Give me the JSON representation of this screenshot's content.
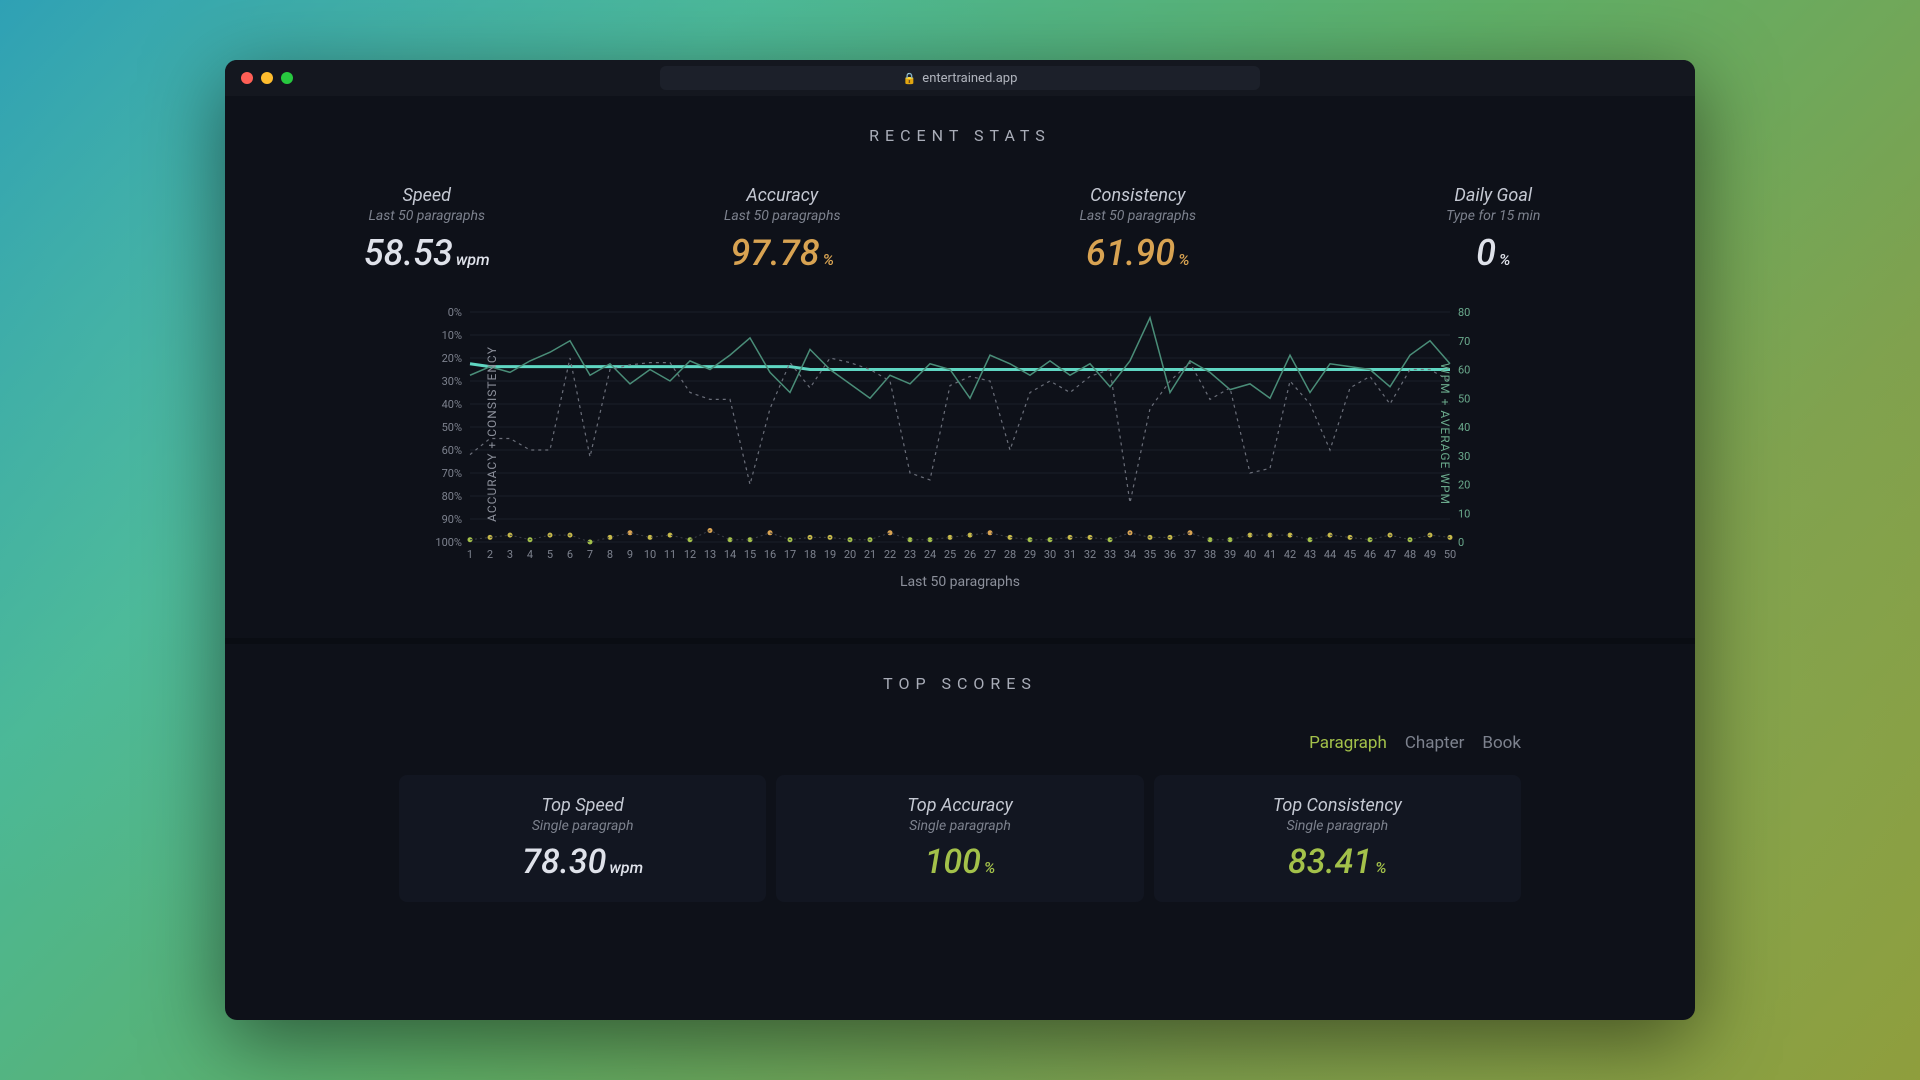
{
  "browser": {
    "url": "entertrained.app"
  },
  "recent": {
    "title": "RECENT STATS",
    "cards": [
      {
        "title": "Speed",
        "sub": "Last 50 paragraphs",
        "value": "58.53",
        "unit": "wpm",
        "color": "c-white"
      },
      {
        "title": "Accuracy",
        "sub": "Last 50 paragraphs",
        "value": "97.78",
        "unit": "%",
        "color": "c-orange"
      },
      {
        "title": "Consistency",
        "sub": "Last 50 paragraphs",
        "value": "61.90",
        "unit": "%",
        "color": "c-orange"
      },
      {
        "title": "Daily Goal",
        "sub": "Type for 15 min",
        "value": "0",
        "unit": "%",
        "color": "c-white"
      }
    ]
  },
  "chart_data": {
    "type": "line",
    "title": "",
    "xlabel": "Last 50 paragraphs",
    "left_axis": {
      "label": "ACCURACY + CONSISTENCY",
      "ticks": [
        "0%",
        "10%",
        "20%",
        "30%",
        "40%",
        "50%",
        "60%",
        "70%",
        "80%",
        "90%",
        "100%"
      ],
      "range": [
        0,
        100
      ]
    },
    "right_axis": {
      "label": "WPM + AVERAGE WPM",
      "ticks": [
        "0",
        "10",
        "20",
        "30",
        "40",
        "50",
        "60",
        "70",
        "80"
      ],
      "range": [
        0,
        80
      ]
    },
    "x": [
      1,
      2,
      3,
      4,
      5,
      6,
      7,
      8,
      9,
      10,
      11,
      12,
      13,
      14,
      15,
      16,
      17,
      18,
      19,
      20,
      21,
      22,
      23,
      24,
      25,
      26,
      27,
      28,
      29,
      30,
      31,
      32,
      33,
      34,
      35,
      36,
      37,
      38,
      39,
      40,
      41,
      42,
      43,
      44,
      45,
      46,
      47,
      48,
      49,
      50
    ],
    "series": [
      {
        "name": "avg_wpm",
        "axis": "right",
        "style": "solid-thick",
        "color": "#5fd6c2",
        "values": [
          62,
          61,
          61,
          61,
          61,
          61,
          61,
          61,
          61,
          61,
          61,
          61,
          61,
          61,
          61,
          61,
          61,
          60,
          60,
          60,
          60,
          60,
          60,
          60,
          60,
          60,
          60,
          60,
          60,
          60,
          60,
          60,
          60,
          60,
          60,
          60,
          60,
          60,
          60,
          60,
          60,
          60,
          60,
          60,
          60,
          60,
          60,
          60,
          60,
          60
        ]
      },
      {
        "name": "wpm",
        "axis": "right",
        "style": "solid-thin",
        "color": "#4a8d78",
        "values": [
          58,
          61,
          59,
          63,
          66,
          70,
          58,
          62,
          55,
          60,
          56,
          63,
          60,
          65,
          71,
          59,
          52,
          67,
          60,
          55,
          50,
          58,
          55,
          62,
          60,
          50,
          65,
          62,
          58,
          63,
          58,
          62,
          54,
          63,
          78,
          52,
          63,
          59,
          53,
          55,
          50,
          65,
          52,
          62,
          61,
          60,
          54,
          65,
          70,
          62
        ]
      },
      {
        "name": "consistency",
        "axis": "left",
        "style": "dashed",
        "color": "#6b6f7a",
        "values": [
          62,
          55,
          55,
          60,
          60,
          20,
          63,
          25,
          23,
          22,
          22,
          35,
          38,
          38,
          75,
          42,
          22,
          33,
          20,
          22,
          25,
          30,
          70,
          73,
          32,
          28,
          30,
          60,
          35,
          30,
          35,
          28,
          25,
          83,
          42,
          30,
          22,
          38,
          33,
          70,
          68,
          30,
          40,
          60,
          33,
          28,
          40,
          25,
          25,
          30
        ]
      },
      {
        "name": "accuracy_dots",
        "axis": "left",
        "style": "dots",
        "color_scale": [
          "#a3c14a",
          "#d8a352"
        ],
        "values": [
          99,
          98,
          97,
          99,
          97,
          97,
          100,
          98,
          96,
          98,
          97,
          99,
          95,
          99,
          99,
          96,
          99,
          98,
          98,
          99,
          99,
          96,
          99,
          99,
          98,
          97,
          96,
          98,
          99,
          99,
          98,
          98,
          99,
          96,
          98,
          98,
          96,
          99,
          99,
          97,
          97,
          97,
          99,
          97,
          98,
          99,
          97,
          99,
          97,
          98
        ]
      }
    ]
  },
  "top": {
    "title": "TOP SCORES",
    "tabs": [
      "Paragraph",
      "Chapter",
      "Book"
    ],
    "active_tab": 0,
    "cards": [
      {
        "title": "Top Speed",
        "sub": "Single paragraph",
        "value": "78.30",
        "unit": "wpm",
        "color": "c-white"
      },
      {
        "title": "Top Accuracy",
        "sub": "Single paragraph",
        "value": "100",
        "unit": "%",
        "color": "c-green"
      },
      {
        "title": "Top Consistency",
        "sub": "Single paragraph",
        "value": "83.41",
        "unit": "%",
        "color": "c-green"
      }
    ]
  }
}
